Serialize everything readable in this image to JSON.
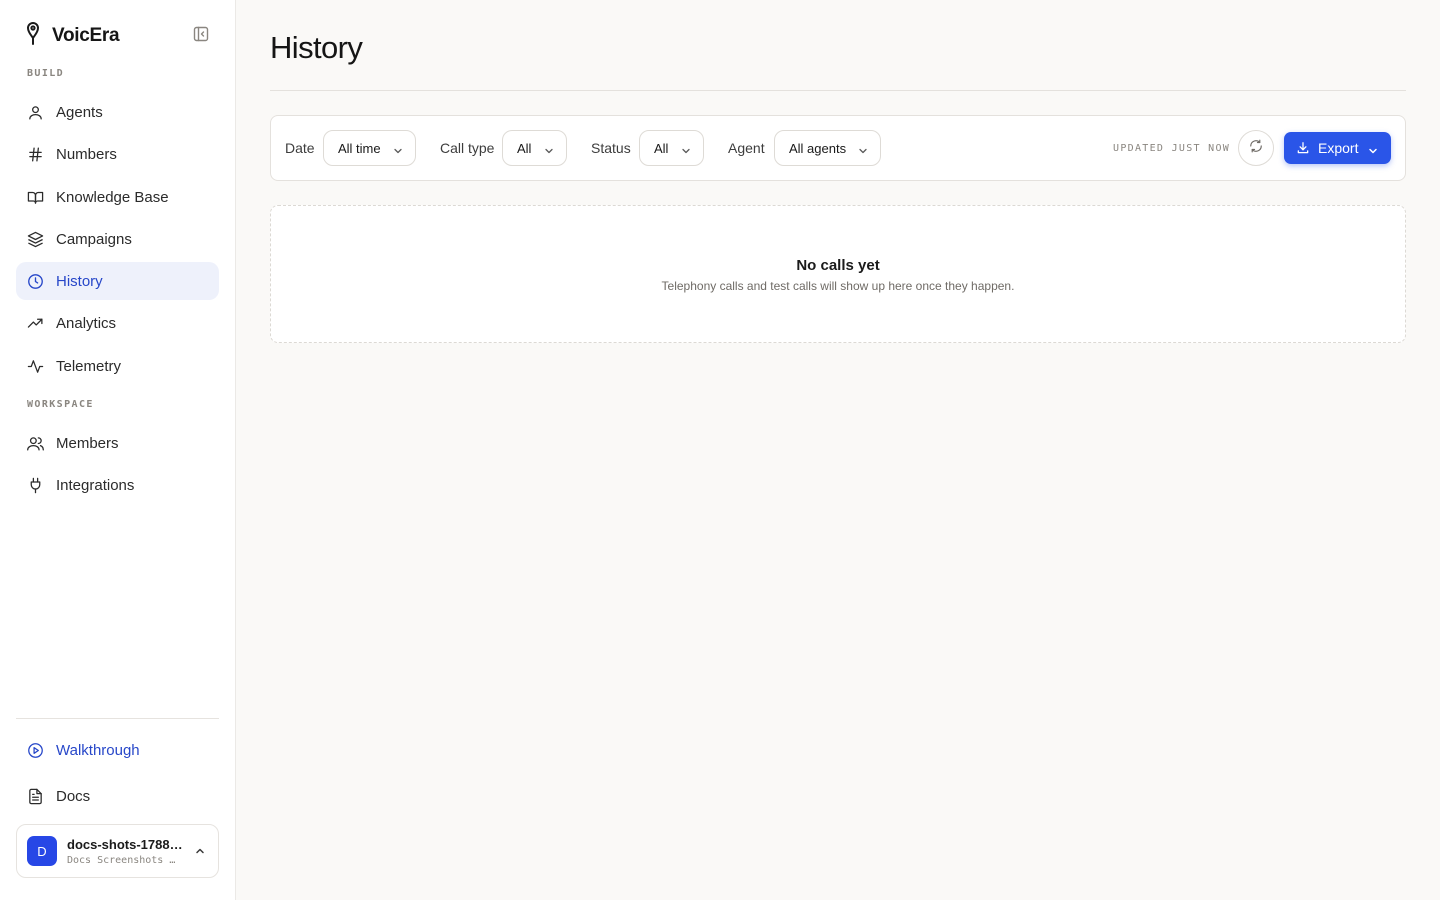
{
  "app": {
    "name": "VoicEra"
  },
  "sidebar": {
    "sections": {
      "build": "BUILD",
      "workspace": "WORKSPACE"
    },
    "build_items": [
      {
        "label": "Agents",
        "icon": "user-icon"
      },
      {
        "label": "Numbers",
        "icon": "hash-icon"
      },
      {
        "label": "Knowledge Base",
        "icon": "book-icon"
      },
      {
        "label": "Campaigns",
        "icon": "layers-icon"
      },
      {
        "label": "History",
        "icon": "clock-icon",
        "active": true
      },
      {
        "label": "Analytics",
        "icon": "trending-up-icon"
      },
      {
        "label": "Telemetry",
        "icon": "activity-icon"
      }
    ],
    "workspace_items": [
      {
        "label": "Members",
        "icon": "users-icon"
      },
      {
        "label": "Integrations",
        "icon": "plug-icon"
      }
    ],
    "footer_items": [
      {
        "label": "Walkthrough",
        "icon": "play-circle-icon"
      },
      {
        "label": "Docs",
        "icon": "file-text-icon"
      }
    ],
    "account": {
      "initial": "D",
      "name": "docs-shots-1788…",
      "subtitle": "Docs Screenshots …"
    }
  },
  "main": {
    "title": "History",
    "filters": {
      "date": {
        "label": "Date",
        "value": "All time"
      },
      "call_type": {
        "label": "Call type",
        "value": "All"
      },
      "status": {
        "label": "Status",
        "value": "All"
      },
      "agent": {
        "label": "Agent",
        "value": "All agents"
      }
    },
    "updated_text": "UPDATED JUST NOW",
    "export_label": "Export",
    "empty": {
      "title": "No calls yet",
      "subtitle": "Telephony calls and test calls will show up here once they happen."
    }
  },
  "colors": {
    "accent": "#2a55e8",
    "active_bg": "#eef1fb",
    "active_text": "#2747c9"
  }
}
